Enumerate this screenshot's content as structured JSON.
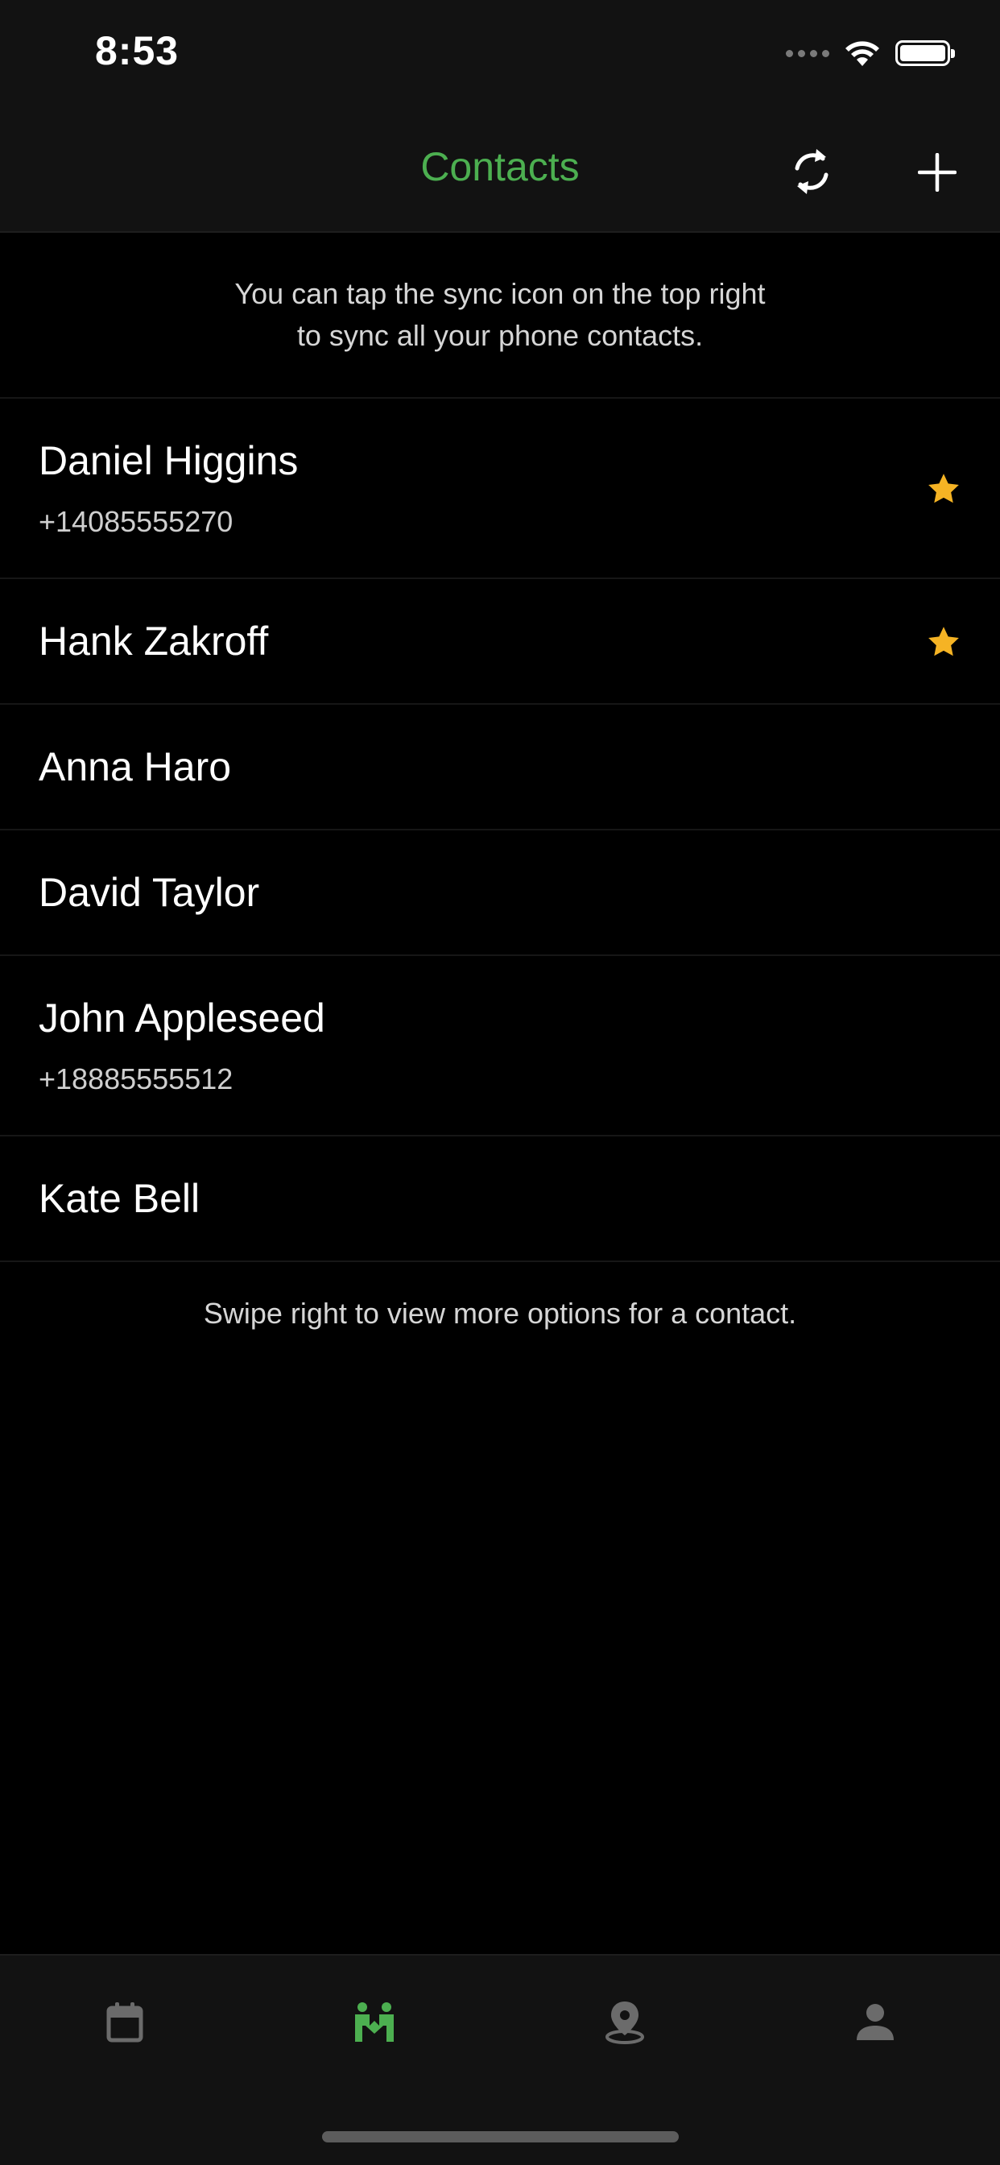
{
  "status_bar": {
    "time": "8:53"
  },
  "nav": {
    "title": "Contacts",
    "sync_icon": "sync-icon",
    "add_icon": "plus-icon"
  },
  "hints": {
    "top_line1": "You can tap the sync icon on the top right",
    "top_line2": "to sync all your phone contacts.",
    "bottom": "Swipe right to view more options for a contact."
  },
  "contacts": [
    {
      "name": "Daniel Higgins",
      "phone": "+14085555270",
      "favorite": true
    },
    {
      "name": "Hank Zakroff",
      "phone": "",
      "favorite": true
    },
    {
      "name": "Anna Haro",
      "phone": "",
      "favorite": false
    },
    {
      "name": "David Taylor",
      "phone": "",
      "favorite": false
    },
    {
      "name": "John Appleseed",
      "phone": "+18885555512",
      "favorite": false
    },
    {
      "name": "Kate Bell",
      "phone": "",
      "favorite": false
    }
  ],
  "tab_bar": {
    "tabs": [
      {
        "icon": "calendar-icon",
        "active": false
      },
      {
        "icon": "people-icon",
        "active": true
      },
      {
        "icon": "map-pin-icon",
        "active": false
      },
      {
        "icon": "profile-icon",
        "active": false
      }
    ]
  },
  "colors": {
    "accent": "#4caf50",
    "star": "#f5b324",
    "inactive_icon": "#6b6b6b",
    "background": "#000000",
    "bar_background": "#121212"
  }
}
